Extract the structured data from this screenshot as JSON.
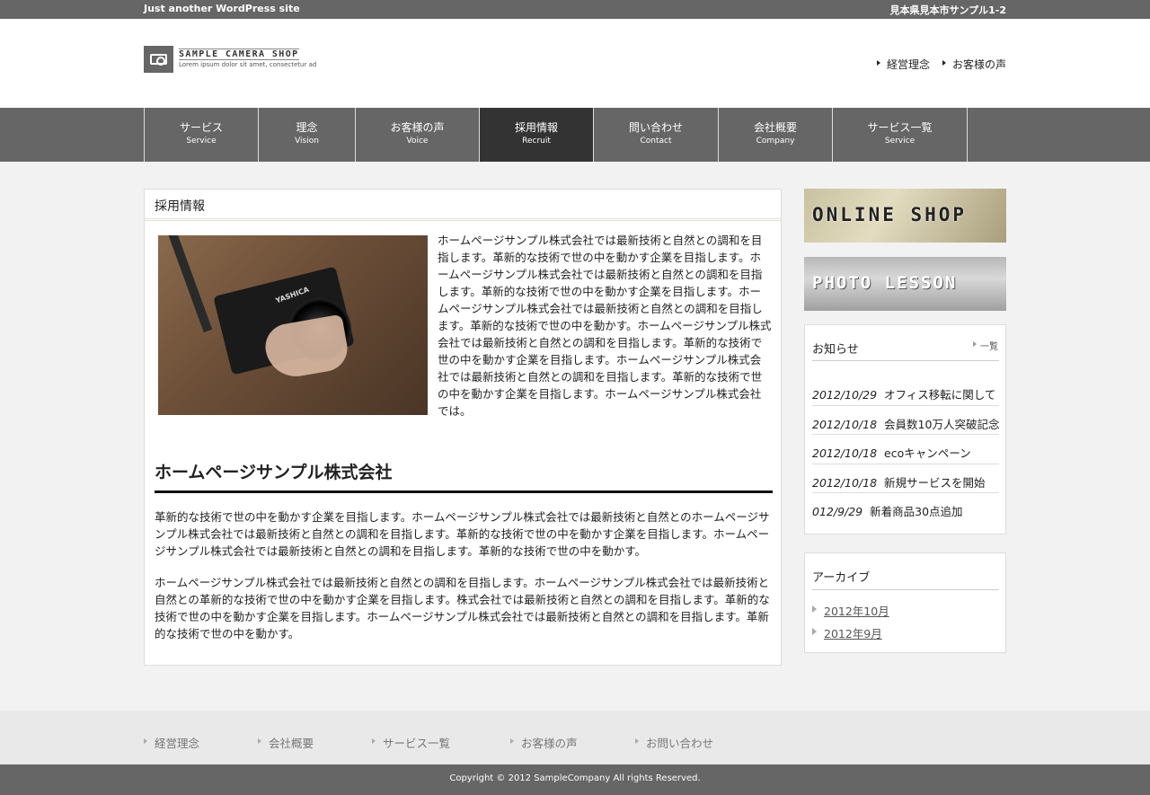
{
  "topbar": {
    "tagline": "Just another WordPress site",
    "address": "見本県見本市サンプル1-2"
  },
  "logo": {
    "title": "SAMPLE CAMERA SHOP",
    "subtitle": "Lorem ipsum dolor sit amet, consectetur ad"
  },
  "header_links": [
    "経営理念",
    "お客様の声"
  ],
  "nav": [
    {
      "jp": "サービス",
      "en": "Service"
    },
    {
      "jp": "理念",
      "en": "Vision"
    },
    {
      "jp": "お客様の声",
      "en": "Voice"
    },
    {
      "jp": "採用情報",
      "en": "Recruit"
    },
    {
      "jp": "問い合わせ",
      "en": "Contact"
    },
    {
      "jp": "会社概要",
      "en": "Company"
    },
    {
      "jp": "サービス一覧",
      "en": "Service"
    }
  ],
  "main": {
    "page_title": "採用情報",
    "photo_brand": "YASHICA",
    "intro": "ホームページサンプル株式会社では最新技術と自然との調和を目指します。革新的な技術で世の中を動かす企業を目指します。ホームページサンプル株式会社では最新技術と自然との調和を目指します。革新的な技術で世の中を動かす企業を目指します。ホームページサンプル株式会社では最新技術と自然との調和を目指します。革新的な技術で世の中を動かす。ホームページサンプル株式会社では最新技術と自然との調和を目指します。革新的な技術で世の中を動かす企業を目指します。ホームページサンプル株式会社では最新技術と自然との調和を目指します。革新的な技術で世の中を動かす企業を目指します。ホームページサンプル株式会社では。",
    "heading": "ホームページサンプル株式会社",
    "para1": "革新的な技術で世の中を動かす企業を目指します。ホームページサンプル株式会社では最新技術と自然とのホームページサンプル株式会社では最新技術と自然との調和を目指します。革新的な技術で世の中を動かす企業を目指します。ホームページサンプル株式会社では最新技術と自然との調和を目指します。革新的な技術で世の中を動かす。",
    "para2": "ホームページサンプル株式会社では最新技術と自然との調和を目指します。ホームページサンプル株式会社では最新技術と自然との革新的な技術で世の中を動かす企業を目指します。株式会社では最新技術と自然との調和を目指します。革新的な技術で世の中を動かす企業を目指します。ホームページサンプル株式会社では最新技術と自然との調和を目指します。革新的な技術で世の中を動かす。"
  },
  "banners": [
    "ONLINE SHOP",
    "PHOTO LESSON"
  ],
  "news": {
    "title": "お知らせ",
    "more": "一覧",
    "items": [
      {
        "date": "2012/10/29",
        "title": "オフィス移転に関して"
      },
      {
        "date": "2012/10/18",
        "title": "会員数10万人突破記念"
      },
      {
        "date": "2012/10/18",
        "title": "ecoキャンペーン"
      },
      {
        "date": "2012/10/18",
        "title": "新規サービスを開始"
      },
      {
        "date": "012/9/29",
        "title": "新着商品30点追加"
      }
    ]
  },
  "archive": {
    "title": "アーカイブ",
    "items": [
      "2012年10月",
      "2012年9月"
    ]
  },
  "footer_links": [
    "経営理念",
    "会社概要",
    "サービス一覧",
    "お客様の声",
    "お問い合わせ"
  ],
  "copyright": "Copyright © 2012 SampleCompany All rights Reserved."
}
